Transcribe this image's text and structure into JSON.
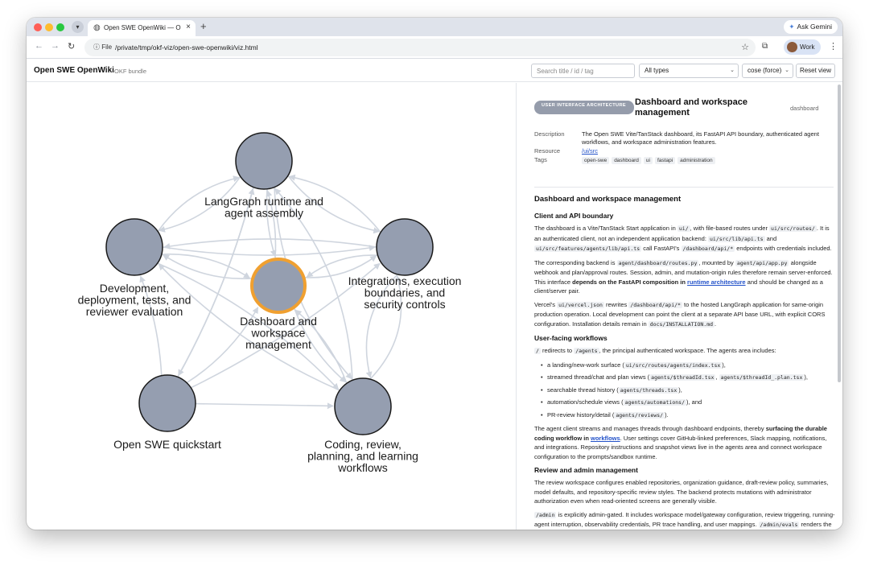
{
  "browser": {
    "tab_title": "Open SWE OpenWiki — OKF",
    "new_tab_glyph": "+",
    "ask_gemini": "Ask Gemini",
    "file_chip": "File",
    "url": "/private/tmp/okf-viz/open-swe-openwiki/viz.html",
    "profile": "Work"
  },
  "app": {
    "title": "Open SWE OpenWiki",
    "subtitle": "OKF bundle",
    "search_placeholder": "Search title / id / tag",
    "types_select": "All types",
    "layout_select": "cose (force)",
    "reset_button": "Reset view"
  },
  "graph": {
    "nodes": [
      {
        "id": "langgraph",
        "lines": [
          "LangGraph runtime and",
          "agent assembly"
        ]
      },
      {
        "id": "development",
        "lines": [
          "Development,",
          "deployment, tests, and",
          "reviewer evaluation"
        ]
      },
      {
        "id": "integrations",
        "lines": [
          "Integrations, execution",
          "boundaries, and",
          "security controls"
        ]
      },
      {
        "id": "dashboard",
        "lines": [
          "Dashboard and",
          "workspace",
          "management"
        ],
        "selected": true
      },
      {
        "id": "quickstart",
        "lines": [
          "Open SWE quickstart"
        ]
      },
      {
        "id": "coding",
        "lines": [
          "Coding, review,",
          "planning, and learning",
          "workflows"
        ]
      }
    ],
    "colors": {
      "node": "#959eb0",
      "selected_ring": "#f0a030",
      "edge": "#cfd5de"
    }
  },
  "panel": {
    "type_badge": "USER INTERFACE ARCHITECTURE",
    "title": "Dashboard and workspace management",
    "slug": "dashboard",
    "description_key": "Description",
    "description": "The Open SWE Vite/TanStack dashboard, its FastAPI API boundary, authenticated agent workflows, and workspace administration features.",
    "resource_key": "Resource",
    "resource": "/ui/src",
    "tags_key": "Tags",
    "tags": [
      "open-swe",
      "dashboard",
      "ui",
      "fastapi",
      "administration"
    ],
    "h_main": "Dashboard and workspace management",
    "h_client": "Client and API boundary",
    "client_p1": {
      "a": "The dashboard is a Vite/TanStack Start application in ",
      "c1": "ui/",
      "b": ", with file-based routes under ",
      "c2": "ui/src/routes/",
      "d": ". It is an authenticated client, not an independent application backend: ",
      "c3": "ui/src/lib/api.ts",
      "e": " and ",
      "c4": "ui/src/features/agents/lib/api.ts",
      "f": " call FastAPI's ",
      "c5": "/dashboard/api/*",
      "g": " endpoints with credentials included."
    },
    "client_p2": {
      "a": "The corresponding backend is ",
      "c1": "agent/dashboard/routes.py",
      "b": ", mounted by ",
      "c2": "agent/api/app.py",
      "c": " alongside webhook and plan/approval routes. Session, admin, and mutation-origin rules therefore remain server-enforced. This interface ",
      "bold": "depends on the FastAPI composition in ",
      "link": "runtime architecture",
      "d": " and should be changed as a client/server pair."
    },
    "client_p3": {
      "a": "Vercel's ",
      "c1": "ui/vercel.json",
      "b": " rewrites ",
      "c2": "/dashboard/api/*",
      "c": " to the hosted LangGraph application for same-origin production operation. Local development can point the client at a separate API base URL, with explicit CORS configuration. Installation details remain in ",
      "c3": "docs/INSTALLATION.md",
      "d": "."
    },
    "h_workflows": "User-facing workflows",
    "wf_intro": {
      "c1": "/",
      "a": " redirects to ",
      "c2": "/agents",
      "b": ", the principal authenticated workspace. The agents area includes:"
    },
    "wf_items": [
      {
        "t": "a landing/new-work surface (",
        "c": "ui/src/routes/agents/index.tsx",
        "e": "),"
      },
      {
        "t": "streamed thread/chat and plan views (",
        "c": "agents/$threadId.tsx",
        "m": ", ",
        "c2": "agents/$threadId_.plan.tsx",
        "e": "),"
      },
      {
        "t": "searchable thread history (",
        "c": "agents/threads.tsx",
        "e": "),"
      },
      {
        "t": "automation/schedule views (",
        "c": "agents/automations/",
        "e": "), and"
      },
      {
        "t": "PR-review history/detail (",
        "c": "agents/reviews/",
        "e": ")."
      }
    ],
    "wf_p2": {
      "a": "The agent client streams and manages threads through dashboard endpoints, thereby ",
      "bold": "surfacing the durable coding workflow in ",
      "link": "workflows",
      "b": ". User settings cover GitHub-linked preferences, Slack mapping, notifications, and integrations. Repository instructions and snapshot views live in the agents area and connect workspace configuration to the prompts/sandbox runtime."
    },
    "h_review": "Review and admin management",
    "review_p1": "The review workspace configures enabled repositories, organization guidance, draft-review policy, summaries, model defaults, and repository-specific review styles. The backend protects mutations with administrator authorization even when read-oriented screens are generally visible.",
    "review_p2": {
      "c1": "/admin",
      "a": " is explicitly admin-gated. It includes workspace model/gateway configuration, review triggering, running-agent interruption, observability credentials, PR trace handling, and user mappings. ",
      "c2": "/admin/evals",
      "b": " renders the latest reviewer-evaluation state/logs exposed by the evaluation store. This"
    }
  }
}
